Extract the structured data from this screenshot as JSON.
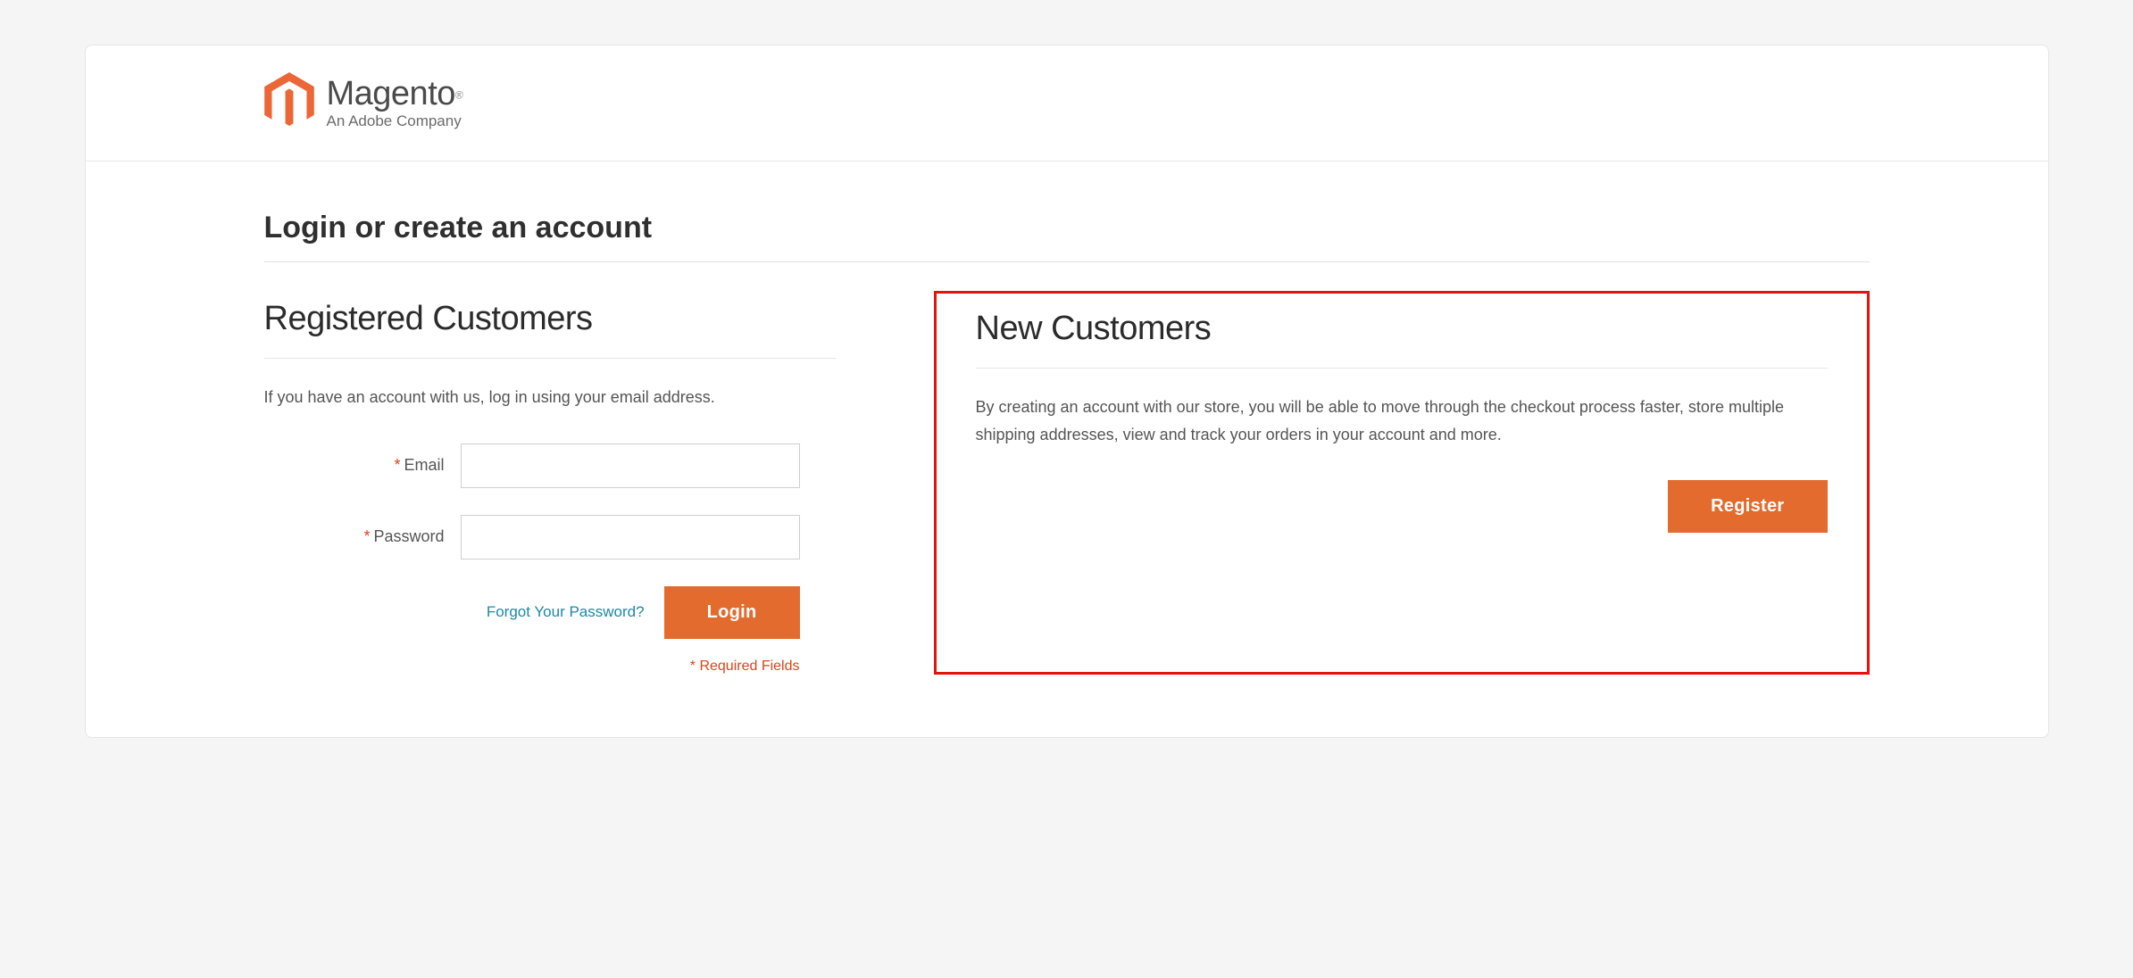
{
  "brand": {
    "name": "Magento",
    "registered": "®",
    "tagline": "An Adobe Company"
  },
  "page_title": "Login or create an account",
  "login": {
    "title": "Registered Customers",
    "description": "If you have an account with us, log in using your email address.",
    "email_label": "Email",
    "password_label": "Password",
    "forgot_link": "Forgot Your Password?",
    "login_button": "Login",
    "required_note": "* Required Fields"
  },
  "register": {
    "title": "New Customers",
    "description": "By creating an account with our store, you will be able to move through the checkout process faster, store multiple shipping addresses, view and track your orders in your account and more.",
    "register_button": "Register"
  }
}
